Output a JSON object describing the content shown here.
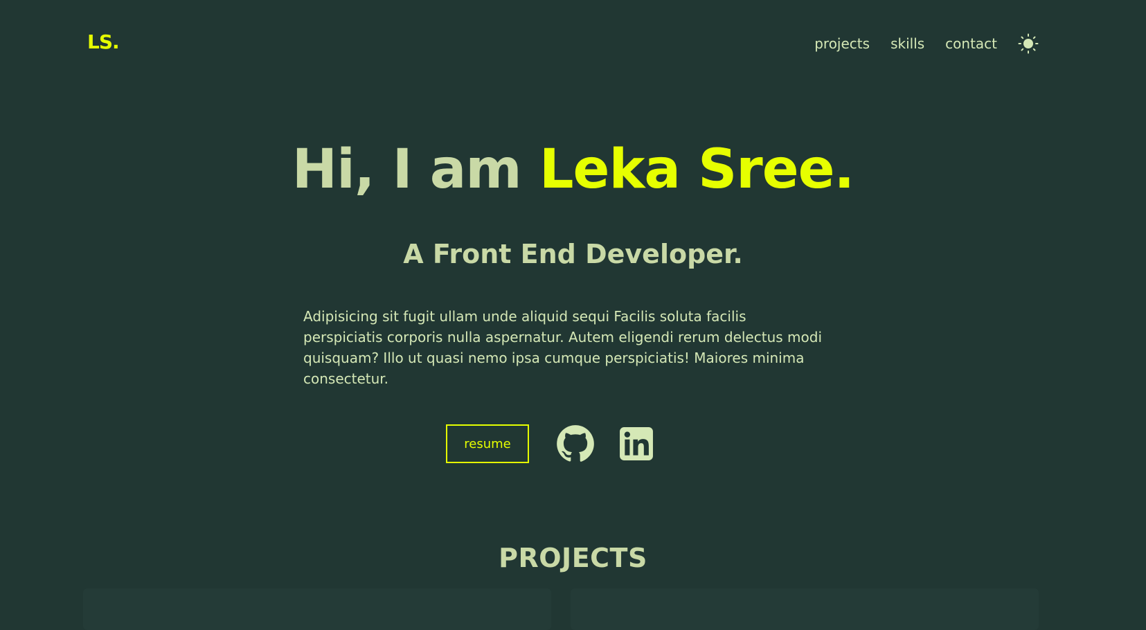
{
  "header": {
    "logo": "LS.",
    "nav": [
      {
        "label": "projects"
      },
      {
        "label": "skills"
      },
      {
        "label": "contact"
      }
    ],
    "theme_icon": "sun-icon"
  },
  "hero": {
    "greeting": "Hi, I am ",
    "name": "Leka Sree.",
    "subtitle": "A Front End Developer.",
    "description": "Adipisicing sit fugit ullam unde aliquid sequi Facilis soluta facilis perspiciatis corporis nulla aspernatur. Autem eligendi rerum delectus modi quisquam? Illo ut quasi nemo ipsa cumque perspiciatis! Maiores minima consectetur.",
    "resume_label": "resume",
    "social_icons": [
      "github-icon",
      "linkedin-icon"
    ]
  },
  "projects": {
    "heading": "PROJECTS"
  },
  "colors": {
    "background": "#213733",
    "accent": "#e6ff00",
    "text_primary": "#c9d9a6",
    "text_secondary": "#d5e8b6"
  }
}
